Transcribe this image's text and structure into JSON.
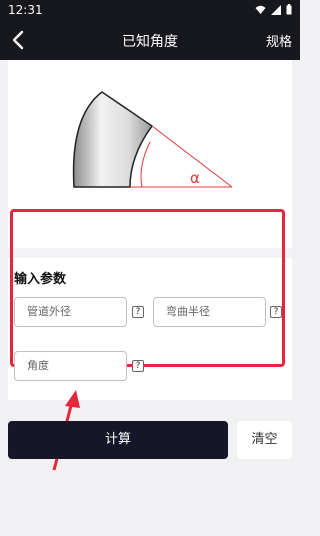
{
  "status_bar": {
    "time": "12:31"
  },
  "app_bar": {
    "title": "已知角度",
    "spec_label": "规格"
  },
  "diagram": {
    "angle_symbol": "α"
  },
  "input_section": {
    "title": "输入参数",
    "pipe_outer_diameter_placeholder": "管道外径",
    "bend_radius_placeholder": "弯曲半径",
    "angle_placeholder": "角度",
    "help_symbol": "?"
  },
  "actions": {
    "calculate_label": "计算",
    "clear_label": "清空"
  },
  "colors": {
    "appbar_bg": "#17171e",
    "button_dark": "#16162a",
    "highlight_red": "#e5263b",
    "angle_red": "#e03a3a"
  }
}
